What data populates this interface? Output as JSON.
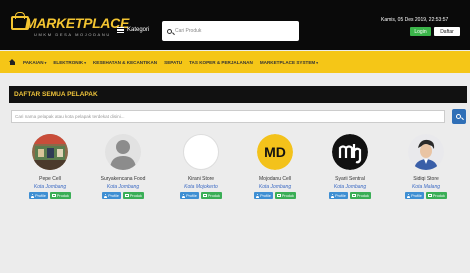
{
  "header": {
    "logo_text": "MARKETPLACE",
    "logo_subtext": "UMKM DESA MOJODANU",
    "kategori_label": "Kategori",
    "search_placeholder": "Cari Produk",
    "datetime": "Kamis, 05 Des 2019, 22:53:57",
    "login_label": "Login",
    "daftar_label": "Daftar"
  },
  "nav": {
    "items": [
      {
        "label": "PAKAIAN",
        "caret": "▾"
      },
      {
        "label": "ELEKTRONIK",
        "caret": "▾"
      },
      {
        "label": "KESEHATAN & KECANTIKAN",
        "caret": ""
      },
      {
        "label": "SEPATU",
        "caret": ""
      },
      {
        "label": "TAS KOPER & PERJALANAN",
        "caret": ""
      },
      {
        "label": "MARKETPLACE SYSTEM",
        "caret": "▾"
      }
    ]
  },
  "panel": {
    "title": "DAFTAR SEMUA PELAPAK",
    "filter_placeholder": "Cari nama pelapak atau kota pelapak terdekat disini..."
  },
  "stores": [
    {
      "name": "Pepe Cell",
      "city": "Kota Jombang",
      "avatar": "photo-shop-avatar",
      "profile_label": "Profile",
      "produk_label": "Produk"
    },
    {
      "name": "Suryakencana Food",
      "city": "Kota Jombang",
      "avatar": "default-user-silhouette",
      "profile_label": "Profile",
      "produk_label": "Produk"
    },
    {
      "name": "Kirani Store",
      "city": "Kota Mojokerto",
      "avatar": "blank-white-avatar",
      "profile_label": "Profile",
      "produk_label": "Produk"
    },
    {
      "name": "Mojodanu Cell",
      "city": "Kota Jombang",
      "avatar": "md-logo-avatar",
      "avatar_text": "MD",
      "profile_label": "Profile",
      "produk_label": "Produk"
    },
    {
      "name": "Syarii Sentral",
      "city": "Kota Jombang",
      "avatar": "mh-logo-avatar",
      "profile_label": "Profile",
      "produk_label": "Produk"
    },
    {
      "name": "Sidiqi Store",
      "city": "Kota Malang",
      "avatar": "person-photo-avatar",
      "profile_label": "Profile",
      "produk_label": "Produk"
    }
  ],
  "colors": {
    "topbar": "#0a0a0a",
    "accent_yellow": "#f5c617",
    "login_green": "#3bb54a",
    "profile_blue": "#3f8fd3",
    "produk_green": "#3aae56",
    "city_blue": "#3d6bc4",
    "search_button_blue": "#2f6fb7"
  }
}
